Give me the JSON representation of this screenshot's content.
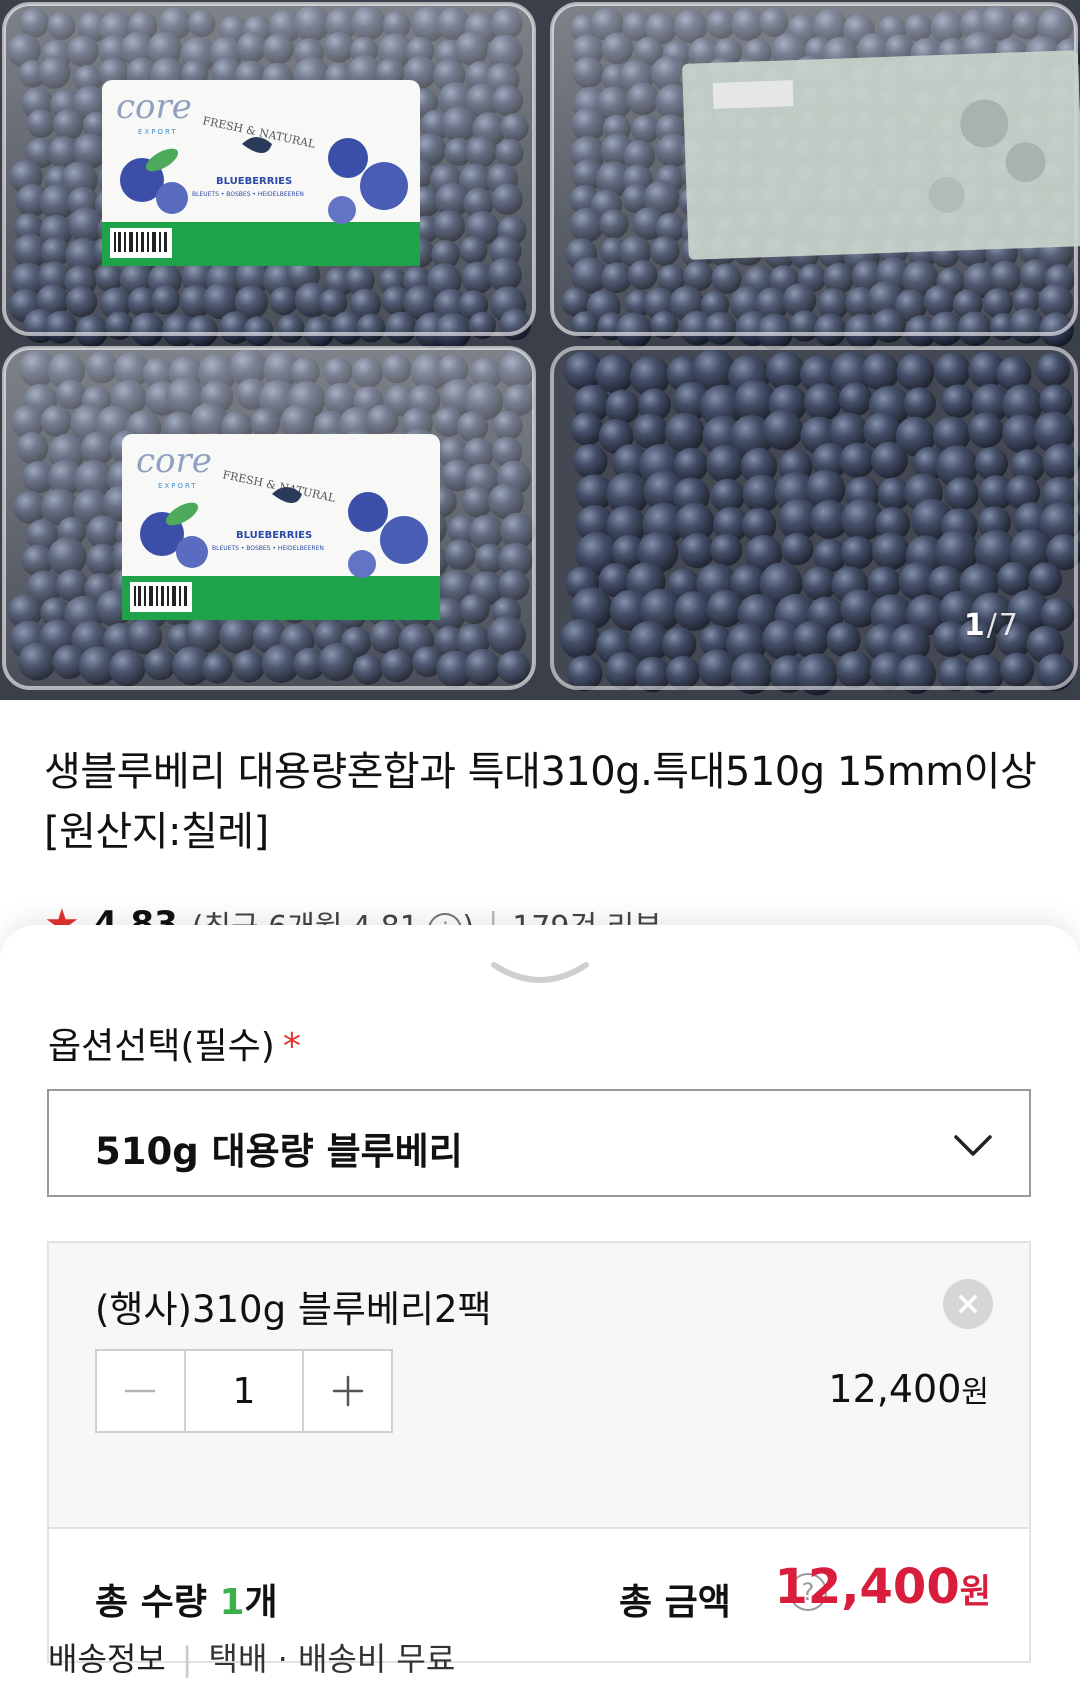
{
  "product_image": {
    "counter_current": "1",
    "counter_separator": "/",
    "counter_total": "7",
    "label_brand": "core",
    "label_brand_sub": "EXPORT",
    "label_tagline": "FRESH & NATURAL",
    "label_product": "BLUEBERRIES",
    "label_product_sub": "BLEUETS • BOSBES • HEIDELBEEREN"
  },
  "product": {
    "title": "생블루베리 대용량혼합과 특대310g.특대510g 15mm이상 [원산지:칠레]",
    "rating_score": "4.83",
    "rating_recent": "(최근 6개월 4.81",
    "rating_recent_close": ")",
    "rating_sep": "|",
    "review_count": "179건 리뷰"
  },
  "sheet": {
    "option_label": "옵션선택(필수)",
    "required_mark": "*",
    "selected_option": "510g 대용량 블루베리",
    "cart_item": {
      "name": "(행사)310g 블루베리2팩",
      "quantity": "1",
      "price": "12,400",
      "price_unit": "원"
    },
    "total": {
      "qty_prefix": "총 수량 ",
      "qty_value": "1",
      "qty_suffix": "개",
      "amount_label": "총 금액",
      "help_icon": "?",
      "amount_value": "12,400",
      "amount_unit": "원"
    },
    "shipping": {
      "label": "배송정보",
      "separator": "|",
      "value": "택배 · 배송비 무료"
    }
  },
  "colors": {
    "accent_red": "#d81e3c",
    "star_red": "#e4312f",
    "qty_green": "#3cb14a",
    "label_green": "#1fa34a"
  }
}
